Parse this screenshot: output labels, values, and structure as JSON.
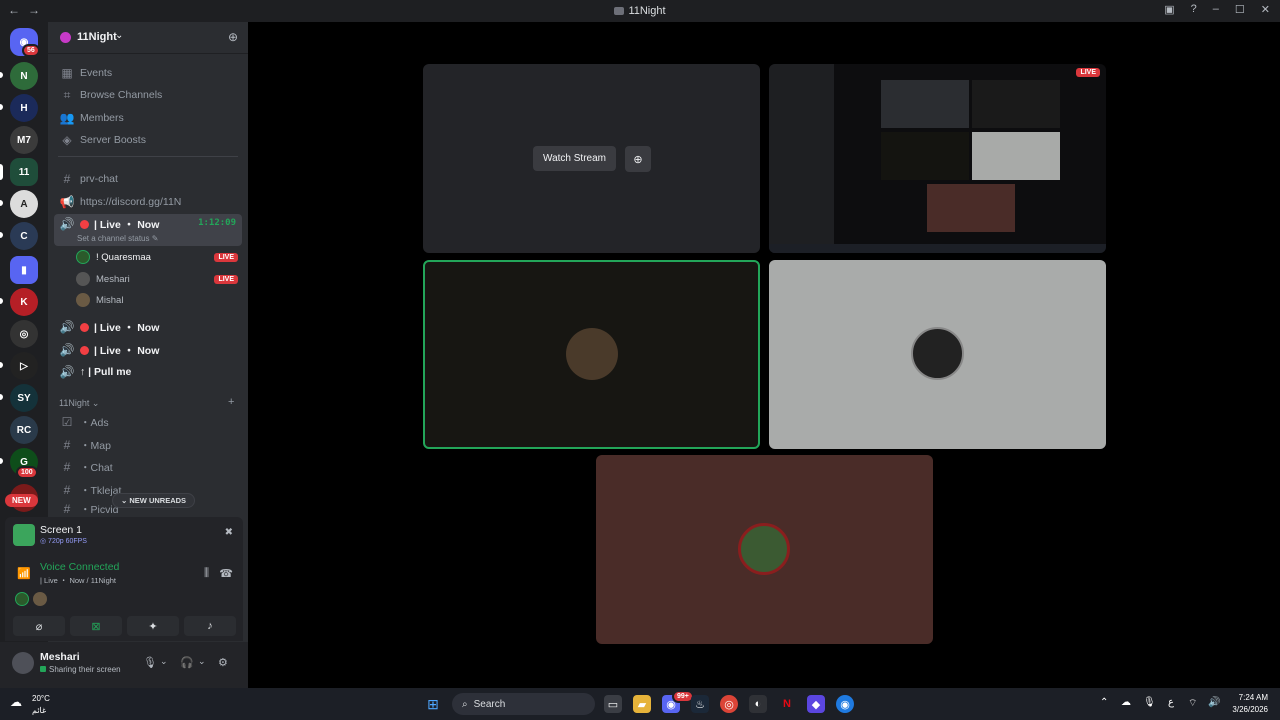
{
  "window": {
    "title": "11Night",
    "nav_back": "←",
    "nav_fwd": "→",
    "ctrl_inbox": "▣",
    "ctrl_help": "?",
    "ctrl_min": "–",
    "ctrl_max": "☐",
    "ctrl_close": "✕"
  },
  "rail": {
    "home_badge": "56",
    "server_badge": "100",
    "new_label": "NEW"
  },
  "guild": {
    "name": "11Night",
    "chevron": "⌄"
  },
  "menu": [
    {
      "icon": "▦",
      "label": "Events"
    },
    {
      "icon": "⌗",
      "label": "Browse Channels"
    },
    {
      "icon": "👥",
      "label": "Members"
    },
    {
      "icon": "◈",
      "label": "Server Boosts"
    }
  ],
  "channels": {
    "prv_chat": "prv-chat",
    "invite_link": "https://discord.gg/11N",
    "live_now_active": "| Live ・ Now",
    "live_timer": "1:12:09",
    "status_hint": "Set a channel status ✎",
    "members": [
      {
        "name": "! Quaresmaa",
        "live": "LIVE"
      },
      {
        "name": "Meshari",
        "live": "LIVE"
      },
      {
        "name": "Mishal",
        "live": ""
      }
    ],
    "live_now_2": "| Live ・ Now",
    "live_now_3": "| Live ・ Now",
    "pull_me": "↑ | Pull me",
    "category": "11Night ⌄",
    "category_plus": "+",
    "text_channels": [
      {
        "icon": "☑",
        "label": "・Ads"
      },
      {
        "icon": "#",
        "label": "・Map"
      },
      {
        "icon": "#",
        "label": "・Chat"
      },
      {
        "icon": "#",
        "label": "・Tklejat"
      },
      {
        "icon": "#",
        "label": "・Picvid"
      }
    ],
    "new_unreads": "⌄ NEW UNREADS"
  },
  "stream_panel": {
    "title": "Screen 1",
    "quality": "◎ 720p 60FPS",
    "voice_status": "Voice Connected",
    "voice_channel": "| Live ・ Now / 11Night"
  },
  "user": {
    "name": "Meshari",
    "status": "Sharing their screen"
  },
  "stage": {
    "watch_label": "Watch Stream",
    "live_tag": "LIVE"
  },
  "taskbar": {
    "temp": "20°C",
    "weather_sub": "غائم",
    "search": "Search",
    "time": "7:24 AM",
    "date": "3/26/2026",
    "lang": "ع",
    "notif_badge": "99+"
  },
  "colors": {
    "accent_green": "#23a559",
    "live_red": "#da373c",
    "sidebar_bg": "#2b2d31",
    "rail_bg": "#1e1f22"
  }
}
